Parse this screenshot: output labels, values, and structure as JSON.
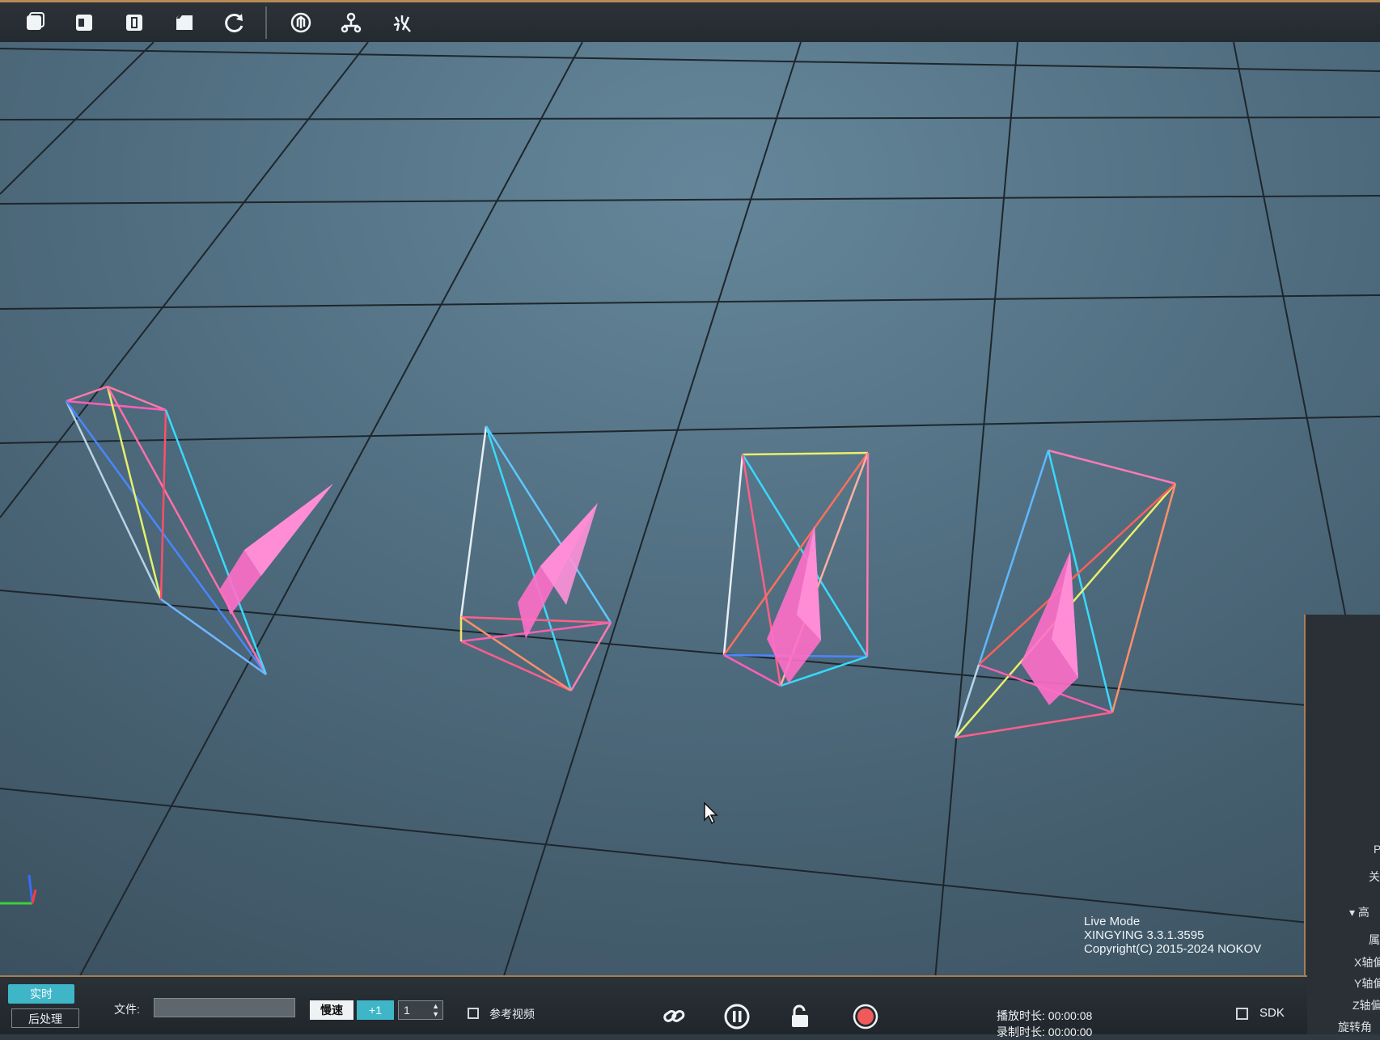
{
  "toolbar": {
    "buttons": [
      {
        "name": "view-perspective-icon"
      },
      {
        "name": "view-front-icon"
      },
      {
        "name": "view-side-icon"
      },
      {
        "name": "view-top-icon"
      },
      {
        "name": "reset-view-icon"
      },
      {
        "name": "tracking-icon"
      },
      {
        "name": "skeleton-icon"
      },
      {
        "name": "test-icon"
      }
    ]
  },
  "viewport": {
    "info": {
      "mode": "Live Mode",
      "version": "XINGYING 3.3.1.3595",
      "copyright": "Copyright(C) 2015-2024 NOKOV"
    }
  },
  "bottom_bar": {
    "mode_live": "实时",
    "mode_post": "后处理",
    "file_label": "文件:",
    "file_value": "",
    "speed_label": "慢速",
    "step_label": "+1",
    "step_value": "1",
    "ref_video_label": "参考视频",
    "play_time_label": "播放时长:",
    "play_time": "00:00:08",
    "rec_time_label": "录制时长:",
    "rec_time": "00:00:00",
    "sdk_label": "SDK"
  },
  "right_panel": {
    "items": [
      "高",
      "属",
      "X轴偏",
      "Y轴偏",
      "Z轴偏",
      "旋转角"
    ],
    "partial": [
      "P",
      "关"
    ]
  },
  "colors": {
    "accent": "#3fb6c8",
    "border": "#a57f55",
    "rigid_body": "#ff6fc8"
  }
}
